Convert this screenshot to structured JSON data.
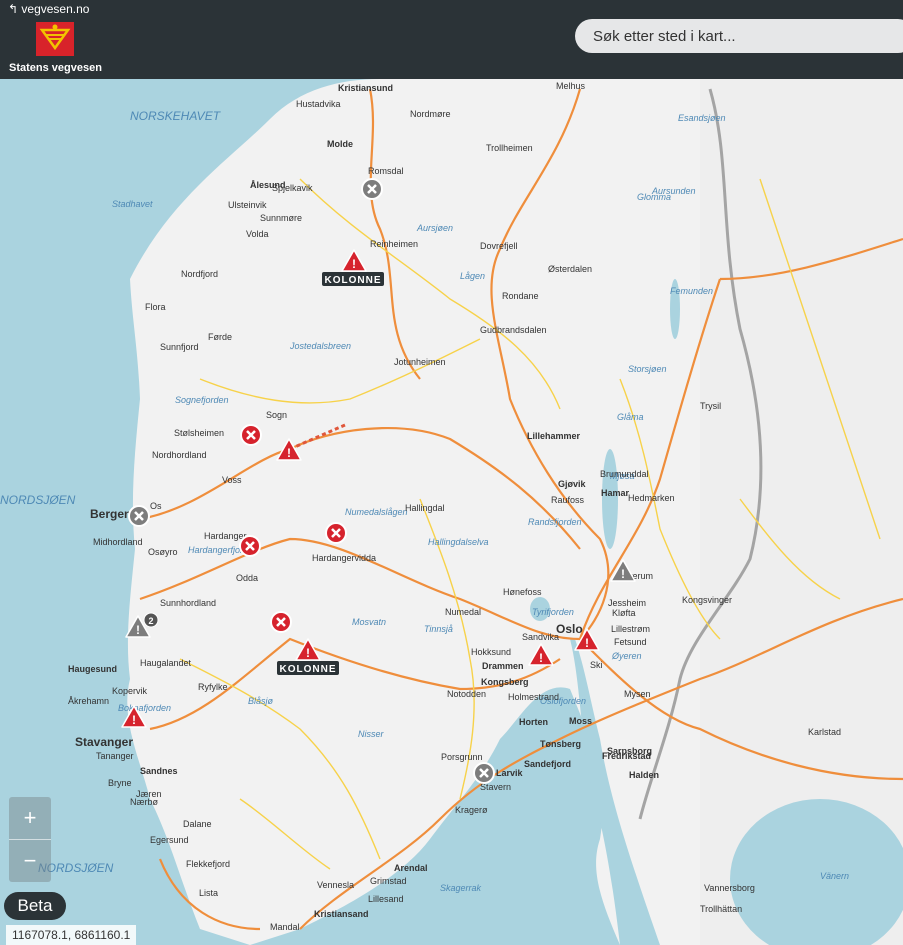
{
  "header": {
    "back_link": "↰ vegvesen.no",
    "brand": "Statens vegvesen",
    "search_placeholder": "Søk etter sted i kart..."
  },
  "map": {
    "places": [
      "Kristiansund",
      "Molde",
      "Ålesund",
      "Spjelkavik",
      "Ulsteinvik",
      "Volda",
      "Nordfjord",
      "Flora",
      "Førde",
      "Sunnfjord",
      "Stølsheimen",
      "Nordhordland",
      "Voss",
      "Bergen",
      "Midhordland",
      "Os",
      "Osøyro",
      "Hardanger",
      "Odda",
      "Sunnhordland",
      "Haugesund",
      "Haugalandet",
      "Kopervik",
      "Åkrehamn",
      "Ryfylke",
      "Stavanger",
      "Tananger",
      "Sandnes",
      "Bryne",
      "Jæren",
      "Nærbø",
      "Egersund",
      "Dalane",
      "Flekkefjord",
      "Lista",
      "Mandal",
      "Kristiansand",
      "Vennesla",
      "Grimstad",
      "Lillesand",
      "Arendal",
      "Kragerø",
      "Porsgrunn",
      "Larvik",
      "Stavern",
      "Sandefjord",
      "Tønsberg",
      "Horten",
      "Holmestrand",
      "Drammen",
      "Kongsberg",
      "Notodden",
      "Hokksund",
      "Numedal",
      "Hønefoss",
      "Sandvika",
      "Oslo",
      "Ski",
      "Mysen",
      "Lillestrøm",
      "Fetsund",
      "Jessheim",
      "Kløfta",
      "Kongsvinger",
      "Elverum",
      "Hamar",
      "Brumunddal",
      "Hedmarken",
      "Gjøvik",
      "Raufoss",
      "Lillehammer",
      "Hallingdal",
      "Gudbrandsdalen",
      "Østerdalen",
      "Rondane",
      "Dovrefjell",
      "Trollheimen",
      "Reinheimen",
      "Romsdal",
      "Nordmøre",
      "Sunnmøre",
      "Jotunheimen",
      "Sogn",
      "Hardangervidda",
      "Trysil",
      "Karlstad",
      "Vannersborg",
      "Trollhättan",
      "Sarpsborg",
      "Fredrikstad",
      "Halden",
      "Moss",
      "Melhus",
      "Hustadvika"
    ],
    "water": [
      "NORSKEHAVET",
      "NORDSJØEN",
      "NORDSJØEN",
      "Stadhavet",
      "Sognefjorden",
      "Hardangerfjorden",
      "Boknafjorden",
      "Skagerrak",
      "Oslofjorden",
      "Aursjøen",
      "Lågen",
      "Femunden",
      "Storsjøen",
      "Glåma",
      "Mjøsa",
      "Randsfjorden",
      "Tyrifjorden",
      "Tinnsjå",
      "Mosvatn",
      "Blåsjø",
      "Nisser",
      "Hallingdalselva",
      "Numedalslågen",
      "Jostedalsbreen",
      "Vänern",
      "Glomma",
      "Øyeren",
      "Aursunden",
      "Esandsjøen"
    ],
    "kolonne_label": "KOLONNE",
    "cluster_count": "2"
  },
  "controls": {
    "zoom_in": "+",
    "zoom_out": "−",
    "beta": "Beta"
  },
  "coordinates": "1167078.1, 6861160.1",
  "colors": {
    "header": "#2b3337",
    "sea": "#aad3df",
    "land": "#f2f2f2",
    "major_road": "#ef8e3c",
    "minor_road": "#f7d24a",
    "closed": "#d6232d",
    "warning": "#d6232d"
  }
}
